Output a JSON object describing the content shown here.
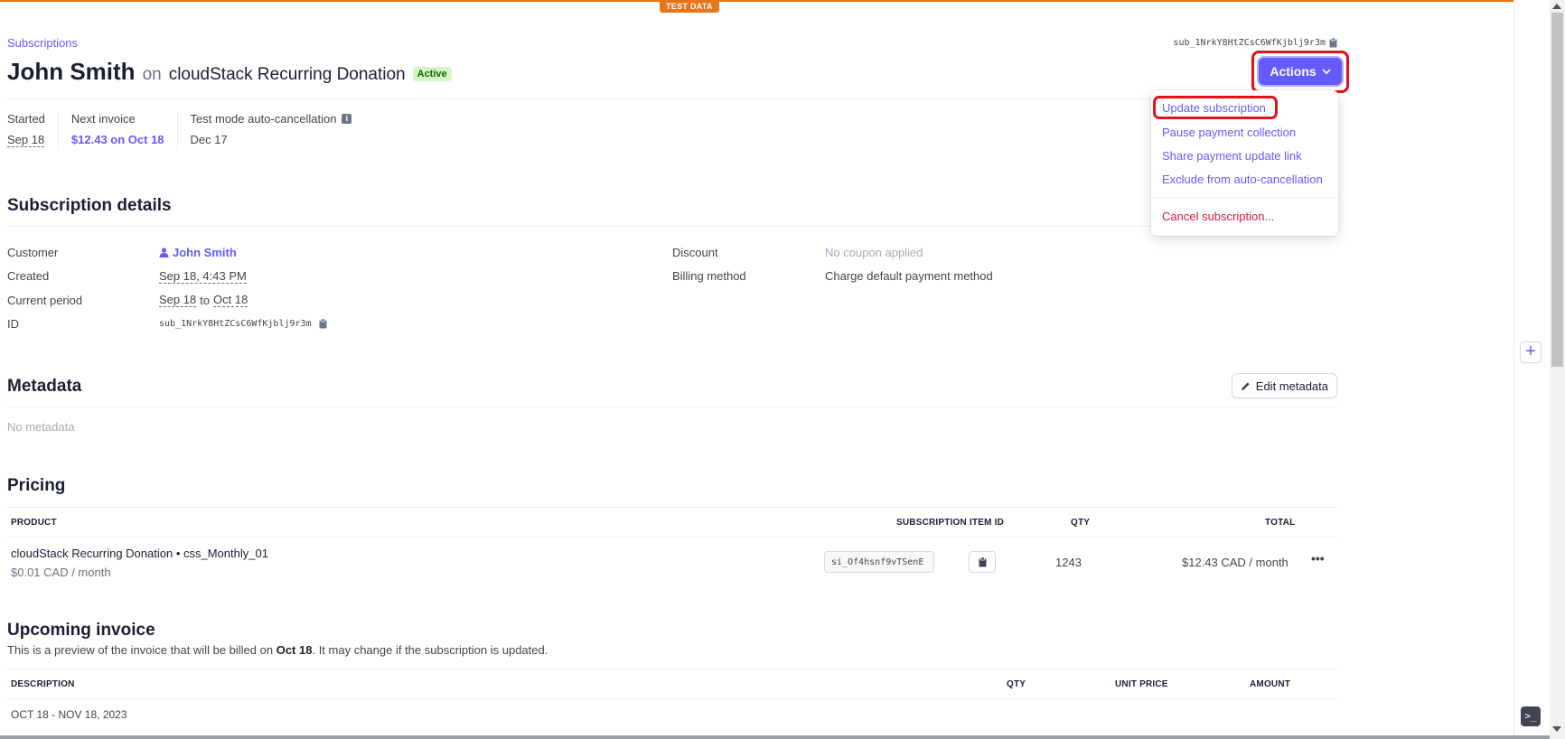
{
  "test_badge": "TEST DATA",
  "breadcrumb": "Subscriptions",
  "subscription_id": "sub_1NrkY8HtZCsC6WfKjblj9r3m",
  "header": {
    "customer_name": "John Smith",
    "on": "on",
    "product": "cloudStack Recurring Donation",
    "status": "Active",
    "actions_label": "Actions"
  },
  "stats": {
    "started_label": "Started",
    "started_value": "Sep 18",
    "next_invoice_label": "Next invoice",
    "next_invoice_value": "$12.43 on Oct 18",
    "auto_cancel_label": "Test mode auto-cancellation",
    "auto_cancel_value": "Dec 17"
  },
  "actions_menu": {
    "items": [
      "Update subscription",
      "Pause payment collection",
      "Share payment update link",
      "Exclude from auto-cancellation"
    ],
    "danger_item": "Cancel subscription..."
  },
  "details": {
    "title": "Subscription details",
    "customer_label": "Customer",
    "customer_value": "John Smith",
    "created_label": "Created",
    "created_value": "Sep 18, 4:43 PM",
    "period_label": "Current period",
    "period_start": "Sep 18",
    "period_to": "to",
    "period_end": "Oct 18",
    "id_label": "ID",
    "id_value": "sub_1NrkY8HtZCsC6WfKjblj9r3m",
    "discount_label": "Discount",
    "discount_value": "No coupon applied",
    "billing_label": "Billing method",
    "billing_value": "Charge default payment method"
  },
  "metadata": {
    "title": "Metadata",
    "edit_label": "Edit metadata",
    "empty": "No metadata"
  },
  "pricing": {
    "title": "Pricing",
    "columns": [
      "PRODUCT",
      "SUBSCRIPTION ITEM ID",
      "QTY",
      "TOTAL"
    ],
    "row": {
      "product": "cloudStack Recurring Donation • css_Monthly_01",
      "unit_price": "$0.01 CAD / month",
      "item_id": "si_Of4hsnf9vTSenE",
      "qty": "1243",
      "total": "$12.43 CAD / month",
      "more": "•••"
    }
  },
  "upcoming": {
    "title": "Upcoming invoice",
    "desc_before": "This is a preview of the invoice that will be billed on ",
    "desc_date": "Oct 18",
    "desc_after": ". It may change if the subscription is updated.",
    "columns": [
      "DESCRIPTION",
      "QTY",
      "UNIT PRICE",
      "AMOUNT"
    ],
    "period": "OCT 18 - NOV 18, 2023"
  },
  "colors": {
    "accent": "#635bff",
    "test_orange": "#e8751a",
    "danger": "#df1b41",
    "highlight_red": "#e0121c"
  }
}
